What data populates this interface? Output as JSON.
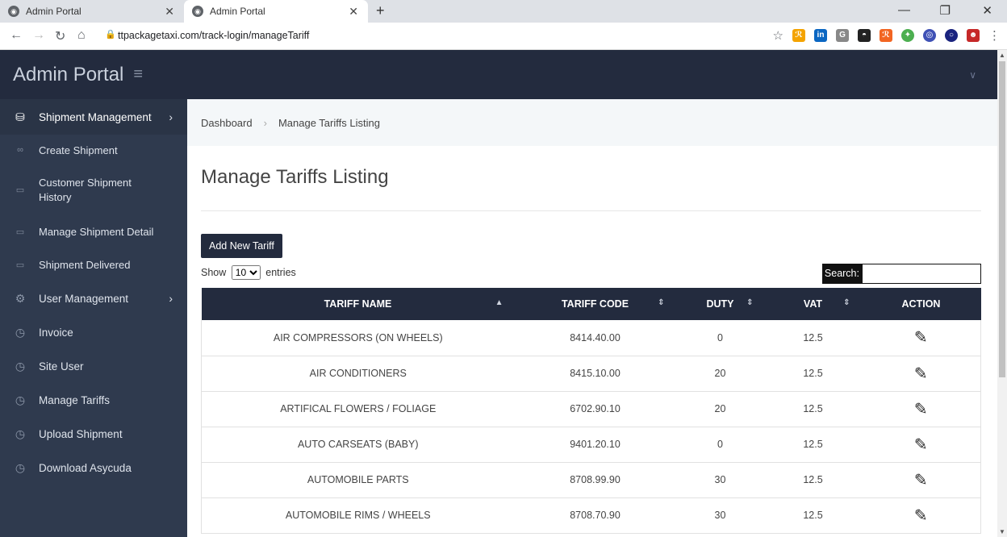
{
  "browser": {
    "tabs": [
      {
        "title": "Admin Portal"
      },
      {
        "title": "Admin Portal"
      }
    ],
    "new_tab": "+",
    "url": "ttpackagetaxi.com/track-login/manageTariff",
    "window_controls": [
      "—",
      "❐",
      "✕"
    ]
  },
  "sidebar": {
    "brand": "Admin Portal",
    "items": [
      {
        "label": "Shipment Management",
        "icon": "database-icon"
      },
      {
        "label": "Create Shipment",
        "icon": "infinity-icon"
      },
      {
        "label": "Customer Shipment History",
        "icon": "monitor-icon"
      },
      {
        "label": "Manage Shipment Detail",
        "icon": "card-icon"
      },
      {
        "label": "Shipment Delivered",
        "icon": "card-icon"
      },
      {
        "label": "User Management",
        "icon": "gear-icon"
      },
      {
        "label": "Invoice",
        "icon": "clock-icon"
      },
      {
        "label": "Site User",
        "icon": "clock-icon"
      },
      {
        "label": "Manage Tariffs",
        "icon": "clock-icon"
      },
      {
        "label": "Upload Shipment",
        "icon": "clock-icon"
      },
      {
        "label": "Download Asycuda",
        "icon": "clock-icon"
      }
    ]
  },
  "breadcrumb": {
    "home": "Dashboard",
    "current": "Manage Tariffs Listing"
  },
  "main": {
    "title": "Manage Tariffs Listing",
    "add_button": "Add New Tariff",
    "show_prefix": "Show",
    "show_value": "10",
    "show_suffix": "entries",
    "search_label": "Search:",
    "search_value": ""
  },
  "table": {
    "headers": [
      "TARIFF NAME",
      "TARIFF CODE",
      "DUTY",
      "VAT",
      "ACTION"
    ],
    "rows": [
      {
        "name": "AIR COMPRESSORS (ON WHEELS)",
        "code": "8414.40.00",
        "duty": "0",
        "vat": "12.5"
      },
      {
        "name": "AIR CONDITIONERS",
        "code": "8415.10.00",
        "duty": "20",
        "vat": "12.5"
      },
      {
        "name": "ARTIFICAL FLOWERS / FOLIAGE",
        "code": "6702.90.10",
        "duty": "20",
        "vat": "12.5"
      },
      {
        "name": "AUTO CARSEATS (BABY)",
        "code": "9401.20.10",
        "duty": "0",
        "vat": "12.5"
      },
      {
        "name": "AUTOMOBILE PARTS",
        "code": "8708.99.90",
        "duty": "30",
        "vat": "12.5"
      },
      {
        "name": "AUTOMOBILE RIMS / WHEELS",
        "code": "8708.70.90",
        "duty": "30",
        "vat": "12.5"
      }
    ]
  },
  "colors": {
    "sidebar": "#2f3a4e",
    "header": "#232b3e",
    "accent": "#232b3e"
  }
}
